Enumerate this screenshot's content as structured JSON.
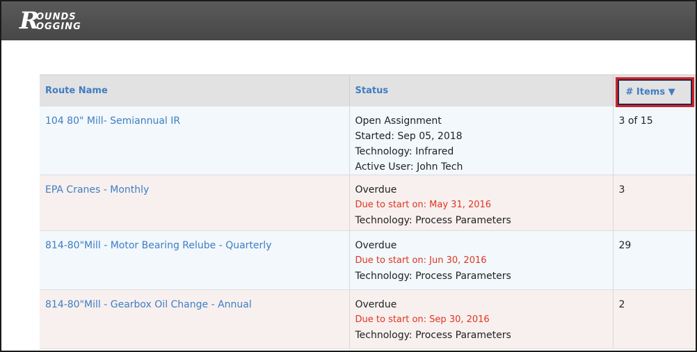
{
  "header": {
    "logo_text": "Rounds Logging"
  },
  "table": {
    "columns": {
      "route_name": "Route Name",
      "status": "Status",
      "items": "# Items ▼"
    },
    "rows": [
      {
        "route": "104 80\" Mill- Semiannual IR",
        "status_lines": [
          "Open Assignment",
          "Started: Sep 05, 2018",
          "Technology: Infrared",
          "Active User: John Tech"
        ],
        "due": "",
        "items": "3 of 15"
      },
      {
        "route": "EPA Cranes - Monthly",
        "status_lines": [
          "Overdue"
        ],
        "due": "Due to start on: May 31, 2016",
        "tech": "Technology: Process Parameters",
        "items": "3"
      },
      {
        "route": "814-80\"Mill - Motor Bearing Relube - Quarterly",
        "status_lines": [
          "Overdue"
        ],
        "due": "Due to start on: Jun 30, 2016",
        "tech": "Technology: Process Parameters",
        "items": "29"
      },
      {
        "route": "814-80\"Mill - Gearbox Oil Change - Annual",
        "status_lines": [
          "Overdue"
        ],
        "due": "Due to start on: Sep 30, 2016",
        "tech": "Technology: Process Parameters",
        "items": "2"
      }
    ]
  },
  "colors": {
    "link": "#3f7dc2",
    "overdue": "#e0341f",
    "highlight": "#d62027"
  }
}
